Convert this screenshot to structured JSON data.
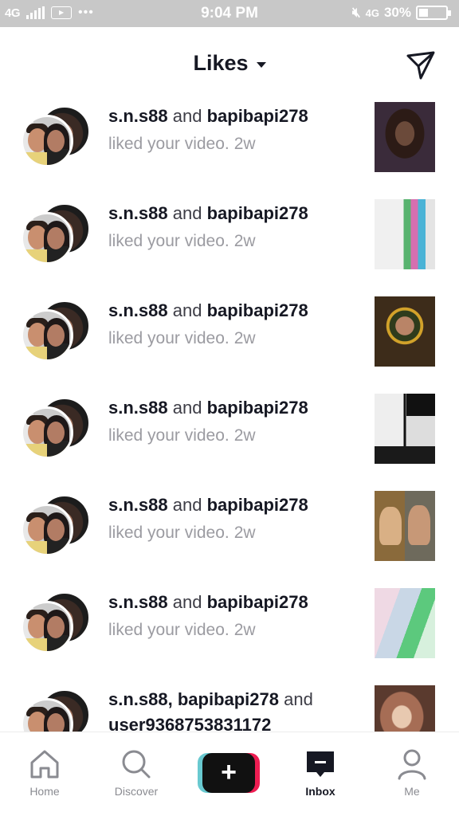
{
  "status_bar": {
    "network": "4G",
    "time": "9:04 PM",
    "network2": "4G",
    "battery": "30%",
    "battery_level": 0.3
  },
  "header": {
    "title": "Likes",
    "icons": [
      "chevron-down-icon",
      "send-icon"
    ]
  },
  "notifications": [
    {
      "user1": "s.n.s88",
      "connector": "and",
      "user2": "bapibapi278",
      "action": "liked your video.",
      "time": "2w"
    },
    {
      "user1": "s.n.s88",
      "connector": "and",
      "user2": "bapibapi278",
      "action": "liked your video.",
      "time": "2w"
    },
    {
      "user1": "s.n.s88",
      "connector": "and",
      "user2": "bapibapi278",
      "action": "liked your video.",
      "time": "2w"
    },
    {
      "user1": "s.n.s88",
      "connector": "and",
      "user2": "bapibapi278",
      "action": "liked your video.",
      "time": "2w"
    },
    {
      "user1": "s.n.s88",
      "connector": "and",
      "user2": "bapibapi278",
      "action": "liked your video.",
      "time": "2w"
    },
    {
      "user1": "s.n.s88",
      "connector": "and",
      "user2": "bapibapi278",
      "action": "liked your video.",
      "time": "2w"
    },
    {
      "user1": "s.n.s88,",
      "user2": "bapibapi278",
      "connector": "and",
      "user3": "user9368753831172"
    }
  ],
  "bottom_nav": {
    "home": "Home",
    "discover": "Discover",
    "create": "+",
    "inbox": "Inbox",
    "me": "Me"
  }
}
